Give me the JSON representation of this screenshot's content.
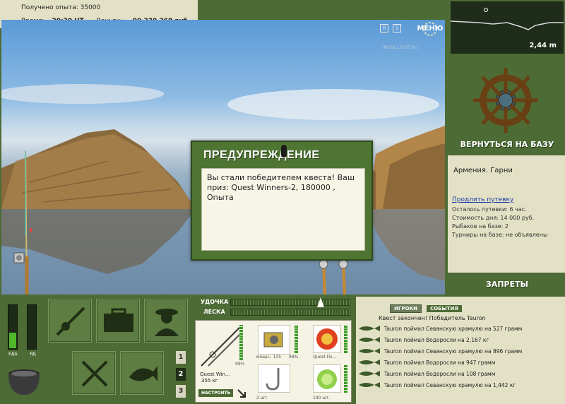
{
  "header": {
    "experience_label": "Получено опыта:",
    "experience_value": "35000",
    "time_label": "Время:",
    "time_value": "20:20 ЧТ",
    "money_label": "Деньги:",
    "money_value": "99 330 368 руб."
  },
  "topbar": {
    "menu_label": "МЕНЮ",
    "pause_icon": "pause-icon",
    "sound_icon": "sound-icon"
  },
  "watermark": "INSTALLSOFT.RU",
  "minimap": {
    "depth": "2,44 m"
  },
  "right_panel": {
    "back_to_base": "ВЕРНУТЬСЯ НА БАЗУ",
    "location": "Армения. Гарни",
    "extend_voucher": "Продлить путевку",
    "lines": [
      "Осталось путевки: 6 час.",
      "Стоимость дня: 14 000 руб.",
      "Рыбаков на базе: 2",
      "Турниры на базе: не объявлены"
    ],
    "bans": "ЗАПРЕТЫ"
  },
  "dialog": {
    "title": "ПРЕДУПРЕЖДЕНИЕ",
    "message": "Вы стали победителем квеста! Ваш приз: Quest Winners-2, 180000 , Опыта"
  },
  "status": {
    "food_label": "ЕДА",
    "poison_label": "ЯД",
    "food_level": 0.35,
    "poison_level": 0.0
  },
  "sliders": {
    "rod_label": "УДОЧКА",
    "line_label": "ЛЕСКА"
  },
  "rod_numbers": [
    "1",
    "2",
    "3"
  ],
  "tackle": {
    "rod_name": "Quest Win...",
    "rod_weight": "355 кг",
    "rod_percent": "99%",
    "reel_power": "мощн.: 135",
    "reel_percent": "98%",
    "line_name": "Quest Fis...",
    "hooks_count": "2 шт.",
    "bait_count": "190 шт.",
    "setup_button": "НАСТРОИТЬ"
  },
  "events": {
    "tab_players": "ИГРОКИ",
    "tab_events": "СОБЫТИЯ",
    "quest_done": "Квест закончен! Победитель Tauron",
    "rows": [
      "Tauron поймал Севанскую храмулю на 527 грамм",
      "Tauron поймал Водоросли на 2,167 кг",
      "Tauron поймал Севанскую храмулю на 896 грамм",
      "Tauron поймал Водоросли на 947 грамм",
      "Tauron поймал Водоросли на 108 грамм",
      "Tauron поймал Севанскую храмулю на 1,442 кг"
    ]
  },
  "colors": {
    "panel_green": "#4d6b35",
    "parchment": "#e3e1c5",
    "accent_green": "#4fb82c"
  }
}
